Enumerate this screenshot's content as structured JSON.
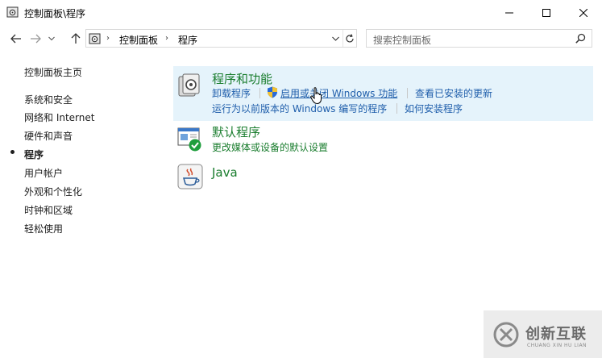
{
  "window": {
    "title": "控制面板\\程序"
  },
  "address": {
    "root": "控制面板",
    "current": "程序"
  },
  "search": {
    "placeholder": "搜索控制面板"
  },
  "sidebar": {
    "items": [
      {
        "label": "控制面板主页"
      },
      {
        "label": "系统和安全"
      },
      {
        "label": "网络和 Internet"
      },
      {
        "label": "硬件和声音"
      },
      {
        "label": "程序",
        "active": true
      },
      {
        "label": "用户帐户"
      },
      {
        "label": "外观和个性化"
      },
      {
        "label": "时钟和区域"
      },
      {
        "label": "轻松使用"
      }
    ]
  },
  "categories": [
    {
      "title": "程序和功能",
      "links": [
        "卸载程序",
        "启用或关闭 Windows 功能",
        "查看已安装的更新",
        "运行为以前版本的 Windows 编写的程序",
        "如何安装程序"
      ]
    },
    {
      "title": "默认程序",
      "links": [
        "更改媒体或设备的默认设置"
      ]
    },
    {
      "title": "Java",
      "links": []
    }
  ],
  "watermark": {
    "text": "创新互联",
    "sub": "CHUANG XIN HU LIAN"
  },
  "colors": {
    "link": "#1f5eab",
    "heading": "#1a7d2e",
    "hover_bg": "#e5f3fb"
  }
}
